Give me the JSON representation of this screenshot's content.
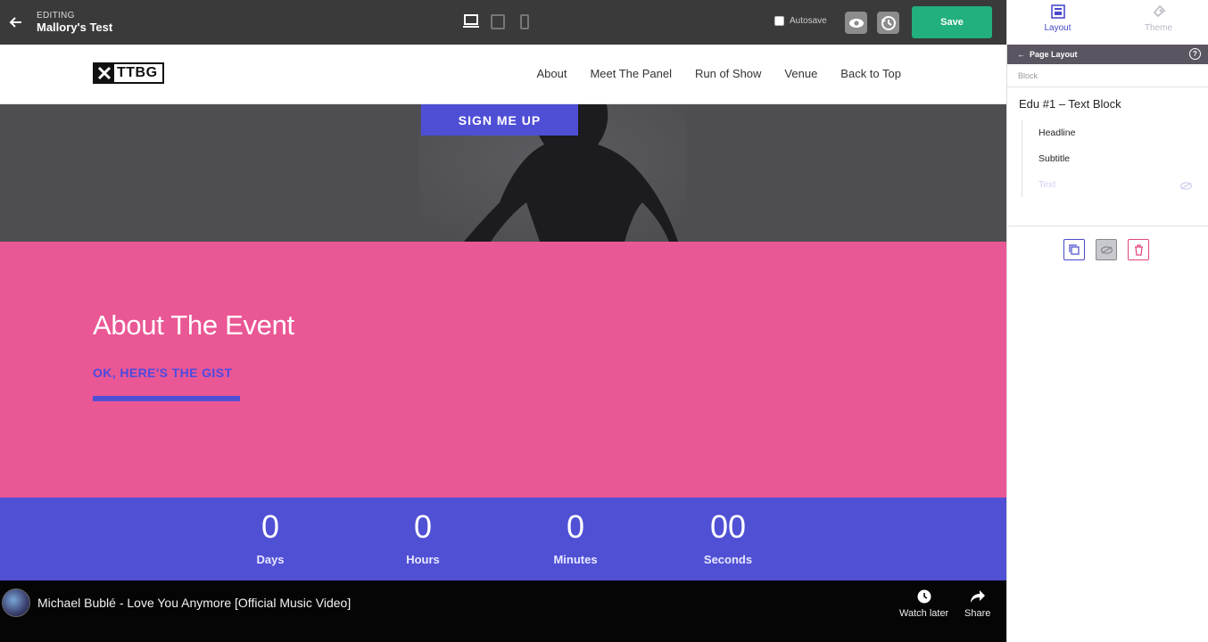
{
  "editor": {
    "editing_label": "EDITING",
    "page_name": "Mallory's Test",
    "autosave_label": "Autosave",
    "save_label": "Save"
  },
  "site_nav": {
    "logo_text": "TTBG",
    "links": [
      "About",
      "Meet The Panel",
      "Run of Show",
      "Venue",
      "Back to Top"
    ]
  },
  "hero": {
    "signup_label": "SIGN ME UP"
  },
  "about": {
    "title": "About The Event",
    "subtitle": "OK, HERE'S THE GIST"
  },
  "countdown": [
    {
      "value": "0",
      "label": "Days"
    },
    {
      "value": "0",
      "label": "Hours"
    },
    {
      "value": "0",
      "label": "Minutes"
    },
    {
      "value": "00",
      "label": "Seconds"
    }
  ],
  "video": {
    "title": "Michael Bublé - Love You Anymore [Official Music Video]",
    "watch_later": "Watch later",
    "share": "Share"
  },
  "panel": {
    "tabs": [
      "Layout",
      "Theme"
    ],
    "header": "Page Layout",
    "block_label": "Block",
    "block_title": "Edu #1 – Text Block",
    "items": [
      "Headline",
      "Subtitle",
      "Text"
    ]
  },
  "colors": {
    "save_green": "#22b07d",
    "about_pink": "#ea5795",
    "accent_indigo": "#5050d5"
  }
}
